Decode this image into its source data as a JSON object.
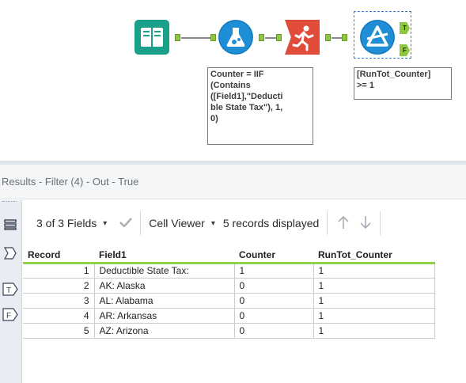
{
  "canvas": {
    "tools": [
      {
        "id": "input",
        "icon": "book-icon",
        "color": "#19a088"
      },
      {
        "id": "formula",
        "icon": "flask-icon",
        "color": "#1e8ed6"
      },
      {
        "id": "multi-row-formula",
        "icon": "running-person-icon",
        "color": "#e04b3a"
      },
      {
        "id": "filter",
        "icon": "triangle-filter-icon",
        "color": "#1e8ed6"
      }
    ],
    "formula_annotation": "Counter = IIF\n(Contains\n([Field1],\"Deducti\nble State Tax\"), 1,\n0)",
    "filter_annotation": "[RunTot_Counter]\n>= 1",
    "true_anchor": "T",
    "false_anchor": "F"
  },
  "results": {
    "title": "Results - Filter (4) - Out - True",
    "fields_label": "3 of 3 Fields",
    "cell_viewer_label": "Cell Viewer",
    "records_label": "5 records displayed",
    "rail_t": "T",
    "rail_f": "F"
  },
  "table": {
    "headers": [
      "Record",
      "Field1",
      "Counter",
      "RunTot_Counter"
    ],
    "rows": [
      [
        "1",
        "Deductible State Tax:",
        "1",
        "1"
      ],
      [
        "2",
        "AK: Alaska",
        "0",
        "1"
      ],
      [
        "3",
        "AL: Alabama",
        "0",
        "1"
      ],
      [
        "4",
        "AR: Arkansas",
        "0",
        "1"
      ],
      [
        "5",
        "AZ: Arizona",
        "0",
        "1"
      ]
    ]
  },
  "colors": {
    "anchor_green": "#8dc63f",
    "selection_blue": "#2f7fd6",
    "header_underline": "#8fd14f"
  }
}
